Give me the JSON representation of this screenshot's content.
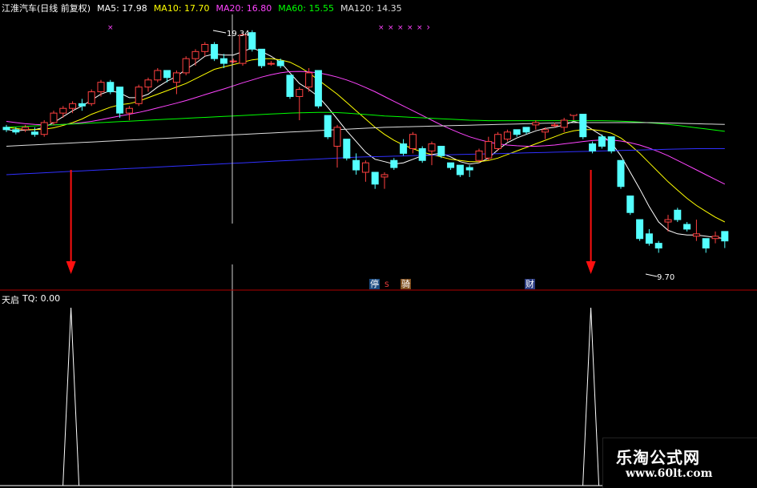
{
  "header": {
    "title": "江淮汽车(日线 前复权)",
    "ma5": "MA5: 17.98",
    "ma10": "MA10: 17.70",
    "ma20": "MA20: 16.80",
    "ma60": "MA60: 15.55",
    "ma120": "MA120: 14.35"
  },
  "colors": {
    "up": "#ff4040",
    "down": "#54ffff",
    "ma5": "#ffffff",
    "ma10": "#ffff00",
    "ma20": "#ff44ff",
    "ma60": "#00ff00",
    "ma120": "#dddddd",
    "divider": "#b00000",
    "arrow": "#ff1010"
  },
  "annotations": {
    "high_label": "19.34",
    "low_label": "9.70"
  },
  "markers": {
    "ting": "停",
    "s": "S",
    "jiang": "骑",
    "cai": "财"
  },
  "indicator": {
    "name": "天启",
    "label": "TQ: 0.00"
  },
  "watermark": {
    "title": "乐淘公式网",
    "url": "www.60lt.com"
  },
  "chart_data": {
    "type": "candlestick",
    "price_axis_range": [
      9.0,
      20.0
    ],
    "candles": [
      [
        15.3,
        15.4,
        15.1,
        15.2
      ],
      [
        15.2,
        15.3,
        15.0,
        15.1
      ],
      [
        15.2,
        15.4,
        15.1,
        15.3
      ],
      [
        15.1,
        15.3,
        14.9,
        15.0
      ],
      [
        15.0,
        15.6,
        14.9,
        15.5
      ],
      [
        15.5,
        16.0,
        15.4,
        15.9
      ],
      [
        15.9,
        16.2,
        15.7,
        16.1
      ],
      [
        16.1,
        16.4,
        15.9,
        16.3
      ],
      [
        16.3,
        16.5,
        16.0,
        16.2
      ],
      [
        16.3,
        16.9,
        16.2,
        16.8
      ],
      [
        16.8,
        17.3,
        16.6,
        17.2
      ],
      [
        17.2,
        17.3,
        16.7,
        16.8
      ],
      [
        17.0,
        17.0,
        15.7,
        15.9
      ],
      [
        15.9,
        16.2,
        15.6,
        16.1
      ],
      [
        16.3,
        17.1,
        16.2,
        17.0
      ],
      [
        17.0,
        17.4,
        16.8,
        17.3
      ],
      [
        17.3,
        17.8,
        17.2,
        17.7
      ],
      [
        17.7,
        17.7,
        17.2,
        17.4
      ],
      [
        17.2,
        17.7,
        16.7,
        17.6
      ],
      [
        17.6,
        18.3,
        17.5,
        18.2
      ],
      [
        18.2,
        18.6,
        17.9,
        18.5
      ],
      [
        18.5,
        18.9,
        18.3,
        18.8
      ],
      [
        18.8,
        18.9,
        18.1,
        18.2
      ],
      [
        18.2,
        18.4,
        17.8,
        18.0
      ],
      [
        18.1,
        18.2,
        18.0,
        18.1
      ],
      [
        18.0,
        19.3,
        17.9,
        19.2
      ],
      [
        19.3,
        19.4,
        18.5,
        18.6
      ],
      [
        18.6,
        18.6,
        17.8,
        17.9
      ],
      [
        18.0,
        18.1,
        17.9,
        18.0
      ],
      [
        18.1,
        18.2,
        17.8,
        17.9
      ],
      [
        17.5,
        17.5,
        16.5,
        16.6
      ],
      [
        16.6,
        17.0,
        15.6,
        16.9
      ],
      [
        17.0,
        17.8,
        16.8,
        17.6
      ],
      [
        17.7,
        17.7,
        16.1,
        16.2
      ],
      [
        15.8,
        15.8,
        14.8,
        14.9
      ],
      [
        14.5,
        15.4,
        13.6,
        15.3
      ],
      [
        14.8,
        14.8,
        13.9,
        14.0
      ],
      [
        13.9,
        14.2,
        13.3,
        13.5
      ],
      [
        13.4,
        13.9,
        13.0,
        13.8
      ],
      [
        13.4,
        13.4,
        12.7,
        12.9
      ],
      [
        13.2,
        13.4,
        12.7,
        13.3
      ],
      [
        13.9,
        14.0,
        13.5,
        13.6
      ],
      [
        14.6,
        14.8,
        14.1,
        14.2
      ],
      [
        14.4,
        15.1,
        14.2,
        15.0
      ],
      [
        14.4,
        14.5,
        13.8,
        13.9
      ],
      [
        14.3,
        14.7,
        13.7,
        14.6
      ],
      [
        14.5,
        14.5,
        14.0,
        14.1
      ],
      [
        13.8,
        13.8,
        13.5,
        13.6
      ],
      [
        13.7,
        13.7,
        13.2,
        13.3
      ],
      [
        13.6,
        13.7,
        13.2,
        13.5
      ],
      [
        13.9,
        14.4,
        13.8,
        14.3
      ],
      [
        14.0,
        14.9,
        13.9,
        14.7
      ],
      [
        14.4,
        15.1,
        14.3,
        15.0
      ],
      [
        14.8,
        15.2,
        14.7,
        15.1
      ],
      [
        15.2,
        15.2,
        14.9,
        15.0
      ],
      [
        15.3,
        15.3,
        15.0,
        15.1
      ],
      [
        15.4,
        15.6,
        15.2,
        15.5
      ],
      [
        15.1,
        15.3,
        14.8,
        15.2
      ],
      [
        15.4,
        15.5,
        15.3,
        15.4
      ],
      [
        15.3,
        15.7,
        15.1,
        15.6
      ],
      [
        15.8,
        16.2,
        15.6,
        16.1
      ],
      [
        16.2,
        16.2,
        14.8,
        14.9
      ],
      [
        14.6,
        14.7,
        14.2,
        14.3
      ],
      [
        14.9,
        15.0,
        14.4,
        14.5
      ],
      [
        14.9,
        14.9,
        14.2,
        14.3
      ],
      [
        13.9,
        13.9,
        12.7,
        12.8
      ],
      [
        12.4,
        12.4,
        11.6,
        11.7
      ],
      [
        11.4,
        11.4,
        10.5,
        10.6
      ],
      [
        10.8,
        11.0,
        10.3,
        10.4
      ],
      [
        10.4,
        10.5,
        10.0,
        10.2
      ],
      [
        11.3,
        11.6,
        10.9,
        11.4
      ],
      [
        11.8,
        11.9,
        11.3,
        11.4
      ],
      [
        11.2,
        11.3,
        10.9,
        11.0
      ],
      [
        10.7,
        11.4,
        10.5,
        10.8
      ],
      [
        10.6,
        10.6,
        10.0,
        10.2
      ],
      [
        10.6,
        10.9,
        10.4,
        10.7
      ],
      [
        10.9,
        10.9,
        10.2,
        10.5
      ]
    ],
    "ma_series": {
      "MA5": [
        15.2,
        15.15,
        15.18,
        15.2,
        15.3,
        15.5,
        15.75,
        16.0,
        16.2,
        16.45,
        16.7,
        16.85,
        16.75,
        16.55,
        16.55,
        16.7,
        17.0,
        17.25,
        17.45,
        17.75,
        18.0,
        18.3,
        18.4,
        18.35,
        18.35,
        18.5,
        18.65,
        18.5,
        18.3,
        18.05,
        17.6,
        17.15,
        16.9,
        16.6,
        16.15,
        15.65,
        15.15,
        14.7,
        14.25,
        13.95,
        13.85,
        13.75,
        13.8,
        13.95,
        14.1,
        14.15,
        14.2,
        14.05,
        13.85,
        13.75,
        13.8,
        14.0,
        14.35,
        14.65,
        14.85,
        15.0,
        15.15,
        15.25,
        15.3,
        15.4,
        15.55,
        15.45,
        15.2,
        14.95,
        14.65,
        14.1,
        13.4,
        12.7,
        11.95,
        11.3,
        10.95,
        10.8,
        10.75,
        10.75,
        10.7,
        10.65,
        10.6
      ],
      "MA10": [
        15.3,
        15.25,
        15.2,
        15.2,
        15.22,
        15.28,
        15.38,
        15.5,
        15.65,
        15.85,
        16.0,
        16.15,
        16.25,
        16.3,
        16.4,
        16.55,
        16.7,
        16.85,
        17.0,
        17.15,
        17.35,
        17.55,
        17.75,
        17.85,
        17.95,
        18.05,
        18.15,
        18.2,
        18.2,
        18.15,
        18.05,
        17.85,
        17.6,
        17.3,
        17.0,
        16.7,
        16.35,
        16.0,
        15.65,
        15.3,
        15.0,
        14.75,
        14.55,
        14.4,
        14.25,
        14.15,
        14.05,
        13.95,
        13.9,
        13.85,
        13.85,
        13.9,
        14.0,
        14.15,
        14.3,
        14.45,
        14.6,
        14.75,
        14.9,
        15.05,
        15.15,
        15.2,
        15.2,
        15.15,
        15.05,
        14.85,
        14.55,
        14.2,
        13.8,
        13.4,
        13.0,
        12.65,
        12.3,
        12.0,
        11.75,
        11.5,
        11.3
      ],
      "MA20": [
        15.55,
        15.5,
        15.45,
        15.42,
        15.4,
        15.4,
        15.42,
        15.45,
        15.5,
        15.55,
        15.62,
        15.7,
        15.78,
        15.85,
        15.93,
        16.02,
        16.12,
        16.22,
        16.32,
        16.43,
        16.55,
        16.68,
        16.8,
        16.92,
        17.05,
        17.18,
        17.3,
        17.42,
        17.52,
        17.6,
        17.65,
        17.66,
        17.64,
        17.6,
        17.52,
        17.42,
        17.3,
        17.15,
        16.98,
        16.8,
        16.6,
        16.4,
        16.2,
        16.0,
        15.8,
        15.6,
        15.4,
        15.22,
        15.05,
        14.9,
        14.78,
        14.68,
        14.6,
        14.55,
        14.52,
        14.5,
        14.5,
        14.52,
        14.55,
        14.6,
        14.65,
        14.7,
        14.74,
        14.76,
        14.76,
        14.72,
        14.65,
        14.55,
        14.42,
        14.27,
        14.1,
        13.9,
        13.7,
        13.5,
        13.3,
        13.1,
        12.9
      ],
      "MA60": [
        15.3,
        15.32,
        15.34,
        15.36,
        15.38,
        15.4,
        15.42,
        15.44,
        15.46,
        15.48,
        15.5,
        15.52,
        15.54,
        15.56,
        15.58,
        15.6,
        15.62,
        15.64,
        15.66,
        15.68,
        15.7,
        15.72,
        15.74,
        15.76,
        15.78,
        15.8,
        15.82,
        15.84,
        15.86,
        15.88,
        15.9,
        15.91,
        15.92,
        15.93,
        15.93,
        15.92,
        15.9,
        15.87,
        15.84,
        15.81,
        15.78,
        15.76,
        15.74,
        15.72,
        15.7,
        15.68,
        15.66,
        15.64,
        15.62,
        15.6,
        15.59,
        15.58,
        15.58,
        15.58,
        15.58,
        15.58,
        15.58,
        15.58,
        15.58,
        15.58,
        15.58,
        15.58,
        15.58,
        15.58,
        15.57,
        15.56,
        15.54,
        15.52,
        15.49,
        15.46,
        15.42,
        15.38,
        15.33,
        15.28,
        15.23,
        15.18,
        15.13
      ],
      "MA120": [
        14.5,
        14.52,
        14.54,
        14.56,
        14.58,
        14.6,
        14.62,
        14.64,
        14.66,
        14.68,
        14.7,
        14.72,
        14.74,
        14.76,
        14.78,
        14.8,
        14.82,
        14.84,
        14.86,
        14.88,
        14.9,
        14.92,
        14.94,
        14.96,
        14.98,
        15.0,
        15.02,
        15.04,
        15.06,
        15.08,
        15.1,
        15.12,
        15.14,
        15.16,
        15.18,
        15.2,
        15.22,
        15.24,
        15.26,
        15.28,
        15.3,
        15.31,
        15.32,
        15.33,
        15.34,
        15.35,
        15.36,
        15.37,
        15.38,
        15.39,
        15.4,
        15.41,
        15.42,
        15.43,
        15.44,
        15.45,
        15.46,
        15.47,
        15.48,
        15.49,
        15.5,
        15.5,
        15.5,
        15.5,
        15.5,
        15.5,
        15.5,
        15.5,
        15.5,
        15.49,
        15.48,
        15.47,
        15.46,
        15.45,
        15.44,
        15.43,
        15.42
      ],
      "BLUE": [
        13.3,
        13.32,
        13.34,
        13.36,
        13.38,
        13.4,
        13.42,
        13.44,
        13.46,
        13.48,
        13.5,
        13.52,
        13.54,
        13.56,
        13.58,
        13.6,
        13.62,
        13.64,
        13.66,
        13.68,
        13.7,
        13.72,
        13.74,
        13.76,
        13.78,
        13.8,
        13.82,
        13.84,
        13.86,
        13.88,
        13.9,
        13.92,
        13.94,
        13.96,
        13.98,
        14.0,
        14.02,
        14.04,
        14.05,
        14.06,
        14.07,
        14.08,
        14.09,
        14.1,
        14.11,
        14.12,
        14.13,
        14.14,
        14.15,
        14.16,
        14.17,
        14.18,
        14.19,
        14.2,
        14.21,
        14.22,
        14.23,
        14.24,
        14.25,
        14.26,
        14.27,
        14.28,
        14.29,
        14.3,
        14.31,
        14.32,
        14.33,
        14.34,
        14.35,
        14.36,
        14.37,
        14.38,
        14.39,
        14.4,
        14.4,
        14.4,
        14.4
      ]
    },
    "tq_signal_bars": [
      7,
      62
    ],
    "tq_value": 0.0
  }
}
